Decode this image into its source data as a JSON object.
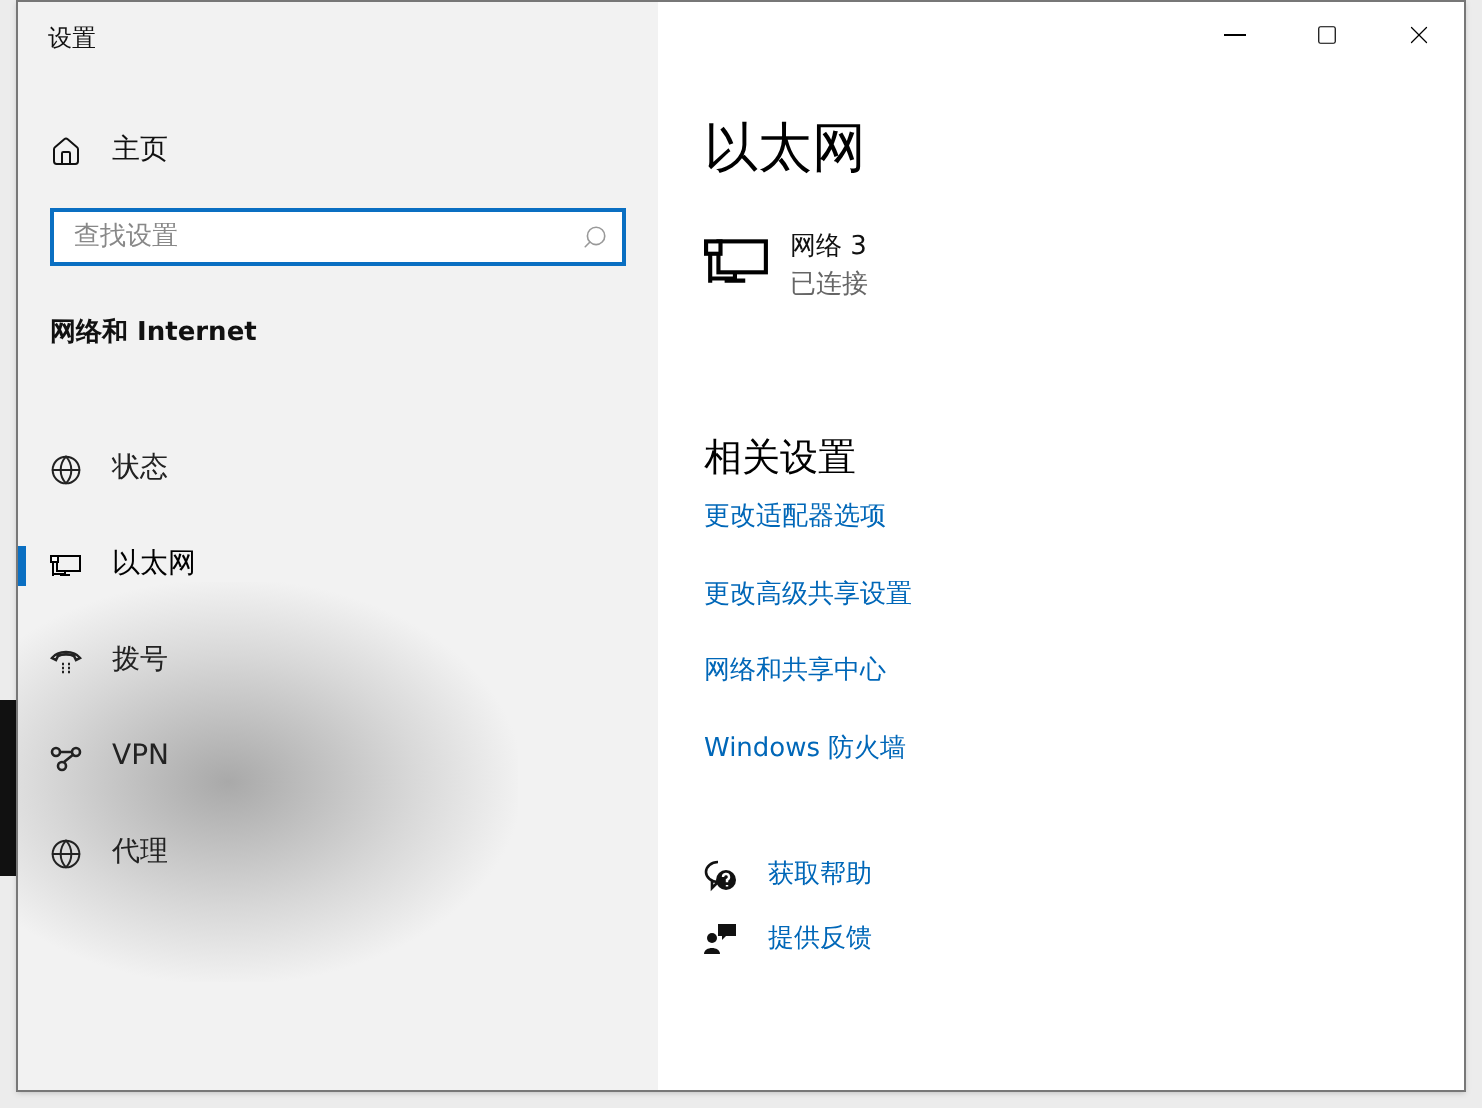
{
  "window": {
    "title": "设置"
  },
  "sidebar": {
    "home": {
      "label": "主页"
    },
    "search": {
      "placeholder": "查找设置"
    },
    "section_title": "网络和 Internet",
    "items": [
      {
        "label": "状态",
        "selected": false
      },
      {
        "label": "以太网",
        "selected": true
      },
      {
        "label": "拨号",
        "selected": false
      },
      {
        "label": "VPN",
        "selected": false
      },
      {
        "label": "代理",
        "selected": false
      }
    ]
  },
  "content": {
    "title": "以太网",
    "network": {
      "name": "网络 3",
      "status": "已连接"
    },
    "related_settings": {
      "title": "相关设置",
      "links": [
        "更改适配器选项",
        "更改高级共享设置",
        "网络和共享中心",
        "Windows 防火墙"
      ]
    },
    "help_links": [
      "获取帮助",
      "提供反馈"
    ]
  }
}
